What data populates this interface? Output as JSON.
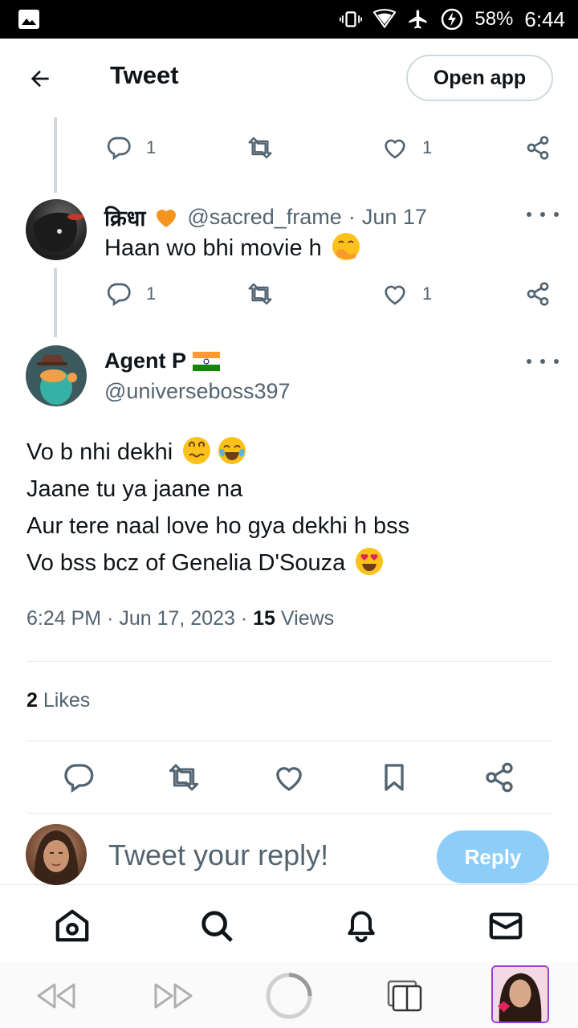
{
  "status_bar": {
    "battery": "58%",
    "time": "6:44"
  },
  "header": {
    "title": "Tweet",
    "open_app_label": "Open app"
  },
  "tweets": [
    {
      "reply_count": "1",
      "like_count": "1"
    },
    {
      "name": "क्रिधा",
      "handle": "@sacred_frame",
      "separator": "·",
      "date": "Jun 17",
      "text": "Haan wo bhi movie h",
      "reply_count": "1",
      "like_count": "1"
    }
  ],
  "main_tweet": {
    "name": "Agent P",
    "handle": "@universeboss397",
    "lines": [
      "Vo b nhi dekhi",
      "Jaane tu ya jaane na",
      "Aur tere naal love ho gya dekhi h bss",
      "Vo bss bcz of Genelia D'Souza"
    ],
    "time": "6:24 PM",
    "date": "Jun 17, 2023",
    "views_count": "15",
    "views_label": "Views",
    "likes_count": "2",
    "likes_label": "Likes"
  },
  "reply_box": {
    "placeholder": "Tweet your reply!",
    "reply_label": "Reply"
  },
  "colors": {
    "accent_light": "#8ecdf8",
    "muted": "#536471",
    "text": "#0f1419"
  },
  "icons": {
    "reply": "reply-icon",
    "retweet": "retweet-icon",
    "like": "heart-icon",
    "share": "share-icon",
    "bookmark": "bookmark-icon",
    "home": "home-icon",
    "search": "search-icon",
    "notifications": "bell-icon",
    "messages": "mail-icon"
  }
}
